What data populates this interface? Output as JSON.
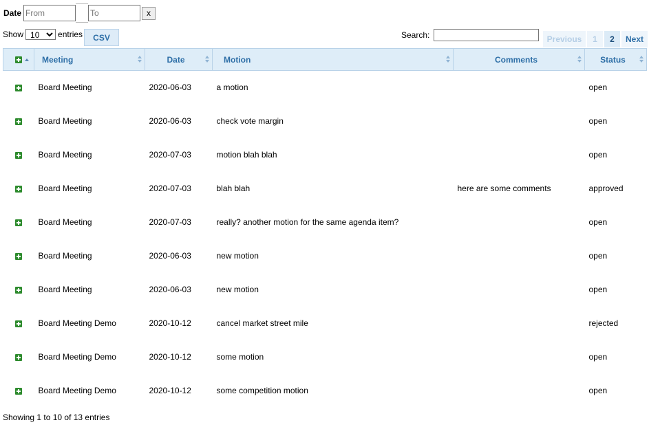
{
  "filter": {
    "label": "Date",
    "from_placeholder": "From",
    "to_placeholder": "To",
    "clear_label": "x"
  },
  "length": {
    "show_label": "Show",
    "selected": "10",
    "entries_label": "entries"
  },
  "csv_label": "CSV",
  "search": {
    "label": "Search:",
    "value": ""
  },
  "pagination": {
    "previous": "Previous",
    "pages": [
      "1",
      "2"
    ],
    "current_page": "2",
    "next": "Next"
  },
  "table": {
    "columns": [
      "Meeting",
      "Date",
      "Motion",
      "Comments",
      "Status"
    ],
    "rows": [
      {
        "meeting": "Board Meeting",
        "date": "2020-06-03",
        "motion": "a motion",
        "comments": "",
        "status": "open"
      },
      {
        "meeting": "Board Meeting",
        "date": "2020-06-03",
        "motion": "check vote margin",
        "comments": "",
        "status": "open"
      },
      {
        "meeting": "Board Meeting",
        "date": "2020-07-03",
        "motion": "motion blah blah",
        "comments": "",
        "status": "open"
      },
      {
        "meeting": "Board Meeting",
        "date": "2020-07-03",
        "motion": "blah blah",
        "comments": "here are some comments",
        "status": "approved"
      },
      {
        "meeting": "Board Meeting",
        "date": "2020-07-03",
        "motion": "really? another motion for the same agenda item?",
        "comments": "",
        "status": "open"
      },
      {
        "meeting": "Board Meeting",
        "date": "2020-06-03",
        "motion": "new motion",
        "comments": "",
        "status": "open"
      },
      {
        "meeting": "Board Meeting",
        "date": "2020-06-03",
        "motion": "new motion",
        "comments": "",
        "status": "open"
      },
      {
        "meeting": "Board Meeting Demo",
        "date": "2020-10-12",
        "motion": "cancel market street mile",
        "comments": "",
        "status": "rejected"
      },
      {
        "meeting": "Board Meeting Demo",
        "date": "2020-10-12",
        "motion": "some motion",
        "comments": "",
        "status": "open"
      },
      {
        "meeting": "Board Meeting Demo",
        "date": "2020-10-12",
        "motion": "some competition motion",
        "comments": "",
        "status": "open"
      }
    ]
  },
  "info": "Showing 1 to 10 of 13 entries",
  "icons": {
    "expand": "plus-square-icon",
    "sort": "sort-arrows-icon"
  },
  "colors": {
    "header_bg": "#deedf8",
    "header_text": "#2e6fa7",
    "expand_icon": "#2e8b2e"
  }
}
